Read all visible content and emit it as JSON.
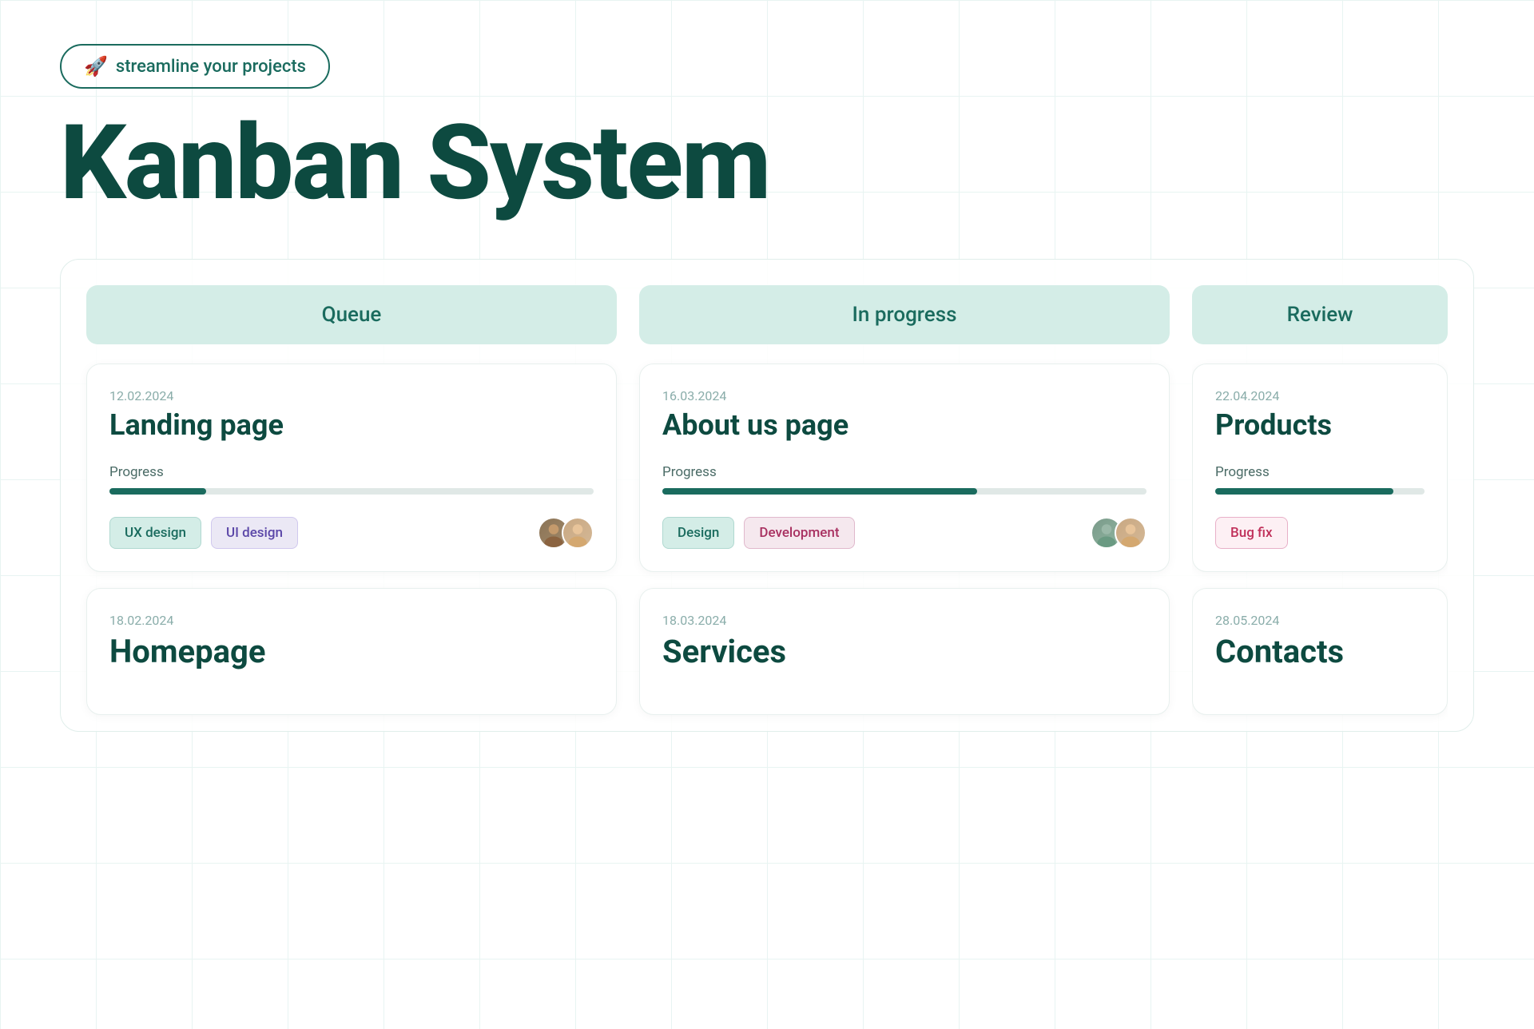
{
  "header": {
    "pill_icon": "🚀",
    "pill_text": "streamline your projects",
    "main_title": "Kanban System"
  },
  "columns": [
    {
      "id": "queue",
      "label": "Queue",
      "cards": [
        {
          "date": "12.02.2024",
          "title": "Landing page",
          "progress_label": "Progress",
          "progress_pct": 20,
          "tags": [
            {
              "text": "UX design",
              "style": "teal"
            },
            {
              "text": "UI design",
              "style": "purple"
            }
          ],
          "avatars": 2
        },
        {
          "date": "18.02.2024",
          "title": "Homepage",
          "progress_label": "",
          "progress_pct": 0,
          "tags": [],
          "avatars": 0
        }
      ]
    },
    {
      "id": "in-progress",
      "label": "In progress",
      "cards": [
        {
          "date": "16.03.2024",
          "title": "About us page",
          "progress_label": "Progress",
          "progress_pct": 65,
          "tags": [
            {
              "text": "Design",
              "style": "teal"
            },
            {
              "text": "Development",
              "style": "pink"
            }
          ],
          "avatars": 2
        },
        {
          "date": "18.03.2024",
          "title": "Services",
          "progress_label": "",
          "progress_pct": 0,
          "tags": [],
          "avatars": 0
        }
      ]
    },
    {
      "id": "review",
      "label": "Review",
      "cards": [
        {
          "date": "22.04.2024",
          "title": "Products",
          "progress_label": "Progress",
          "progress_pct": 85,
          "tags": [
            {
              "text": "Bug fix",
              "style": "pink-outline"
            }
          ],
          "avatars": 0
        },
        {
          "date": "28.05.2024",
          "title": "Contacts",
          "progress_label": "",
          "progress_pct": 0,
          "tags": [],
          "avatars": 0
        }
      ]
    }
  ]
}
